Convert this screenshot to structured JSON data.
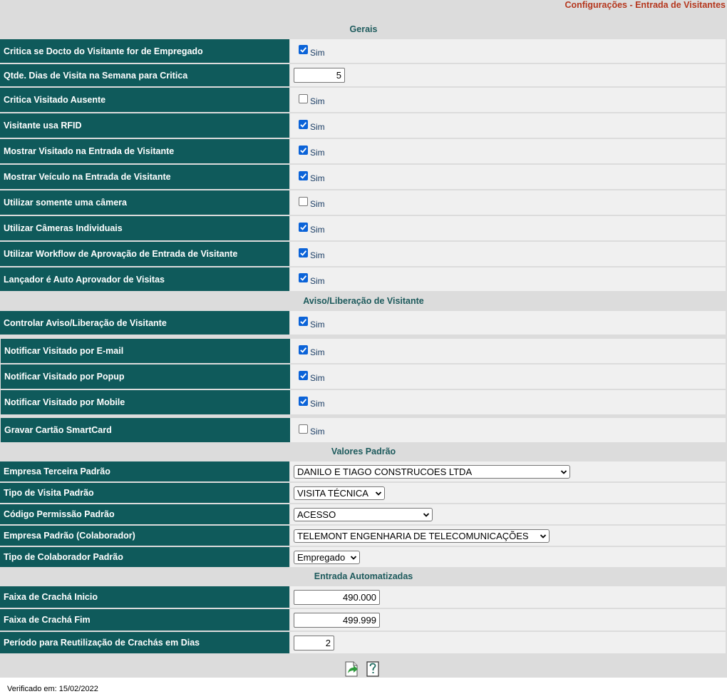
{
  "page_title": "Configurações - Entrada de Visitantes",
  "sections": {
    "gerais": "Gerais",
    "aviso": "Aviso/Liberação de Visitante",
    "valores": "Valores Padrão",
    "entrada": "Entrada Automatizadas"
  },
  "checkbox_label": "Sim",
  "gerais_rows": [
    {
      "label": "Critica se Docto do Visitante for de Empregado",
      "checked": true
    },
    {
      "label": "Qtde. Dias de Visita na Semana para Critica",
      "value": "5"
    },
    {
      "label": "Critica Visitado Ausente",
      "checked": false
    },
    {
      "label": "Visitante usa RFID",
      "checked": true
    },
    {
      "label": "Mostrar Visitado na Entrada de Visitante",
      "checked": true
    },
    {
      "label": "Mostrar Veículo na Entrada de Visitante",
      "checked": true
    },
    {
      "label": "Utilizar somente uma câmera",
      "checked": false
    },
    {
      "label": "Utilizar Câmeras Individuais",
      "checked": true
    },
    {
      "label": "Utilizar Workflow de Aprovação de Entrada de Visitante",
      "checked": true
    },
    {
      "label": "Lançador é Auto Aprovador de Visitas",
      "checked": true
    }
  ],
  "aviso_rows": [
    {
      "label": "Controlar Aviso/Liberação de Visitante",
      "checked": true
    },
    {
      "label": "Notificar Visitado por E-mail",
      "checked": true
    },
    {
      "label": "Notificar Visitado por Popup",
      "checked": true
    },
    {
      "label": "Notificar Visitado por Mobile",
      "checked": true
    },
    {
      "label": "Gravar Cartão SmartCard",
      "checked": false
    }
  ],
  "valores_rows": [
    {
      "label": "Empresa Terceira Padrão",
      "selected": "DANILO E TIAGO CONSTRUCOES LTDA"
    },
    {
      "label": "Tipo de Visita Padrão",
      "selected": "VISITA TÉCNICA"
    },
    {
      "label": "Código Permissão Padrão",
      "selected": "ACESSO"
    },
    {
      "label": "Empresa Padrão (Colaborador)",
      "selected": "TELEMONT ENGENHARIA DE TELECOMUNICAÇÕES"
    },
    {
      "label": "Tipo de Colaborador Padrão",
      "selected": "Empregado"
    }
  ],
  "entrada_rows": [
    {
      "label": "Faixa de Crachá Inicio",
      "value": "490.000"
    },
    {
      "label": "Faixa de Crachá Fim",
      "value": "499.999"
    },
    {
      "label": "Período para Reutilização de Crachás em Dias",
      "value": "2"
    }
  ],
  "footer": {
    "verified": "Verificado em: 15/02/2022",
    "icons": [
      "save-icon",
      "help-icon"
    ]
  },
  "colors": {
    "label_bg": "#0f5a5b",
    "value_bg": "#f0f0f0",
    "section_text": "#1d5a5c",
    "title_text": "#b5381f",
    "checkbox_on": "#0b63d8"
  }
}
